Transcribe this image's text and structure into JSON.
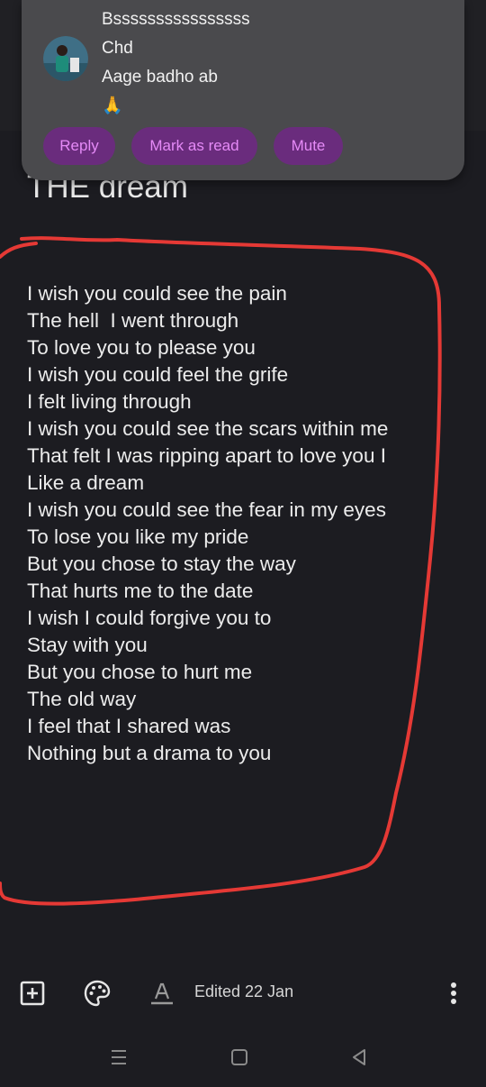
{
  "notification": {
    "lines": [
      "Bssssssssssssssss",
      "Chd",
      "Aage badho ab",
      "🙏"
    ],
    "actions": {
      "reply": "Reply",
      "mark_as_read": "Mark as read",
      "mute": "Mute"
    }
  },
  "note": {
    "title": "THE dream",
    "lines": [
      "I wish you could see the pain",
      "The hell  I went through",
      "To love you to please you",
      "I wish you could feel the grife",
      "I felt living through",
      "I wish you could see the scars within me",
      "That felt I was ripping apart to love you I",
      "Like a dream",
      "I wish you could see the fear in my eyes",
      "To lose you like my pride",
      "But you chose to stay the way",
      "That hurts me to the date",
      "I wish I could forgive you to",
      "Stay with you",
      "But you chose to hurt me",
      "The old way",
      "I feel that I shared was",
      "Nothing but a drama to you"
    ]
  },
  "toolbar": {
    "edited": "Edited 22 Jan",
    "icons": [
      "add-box-icon",
      "palette-icon",
      "text-format-icon",
      "more-vert-icon"
    ]
  },
  "navbar": {
    "icons": [
      "recents-icon",
      "home-icon",
      "back-icon"
    ]
  },
  "colors": {
    "background": "#1c1c21",
    "notification_bg": "#4a4a4d",
    "chip_bg": "#6a2c7d",
    "chip_text": "#e58af7",
    "annotation_red": "#e53935"
  }
}
